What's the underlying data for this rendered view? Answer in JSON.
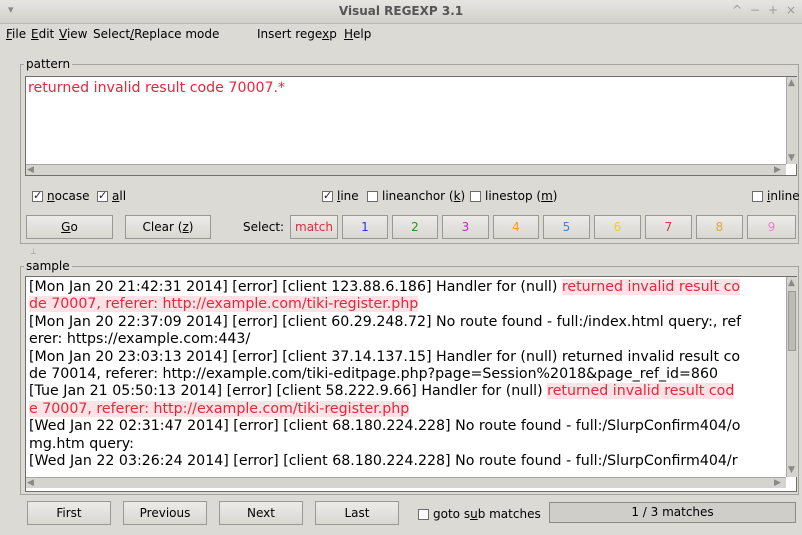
{
  "window": {
    "title": "Visual REGEXP 3.1",
    "controls": [
      "^",
      "−",
      "+",
      "×"
    ]
  },
  "menu": [
    {
      "pre": "",
      "u": "F",
      "post": "ile"
    },
    {
      "pre": "",
      "u": "E",
      "post": "dit"
    },
    {
      "pre": "",
      "u": "V",
      "post": "iew"
    },
    {
      "pre": "Select",
      "u": "/",
      "post": "Replace mode"
    },
    {
      "pre": "Insert rege",
      "u": "x",
      "post": "p"
    },
    {
      "pre": "",
      "u": "H",
      "post": "elp"
    }
  ],
  "pattern": {
    "label": "pattern",
    "value": "returned invalid result code 70007.*"
  },
  "options": {
    "nocase": {
      "pre": "",
      "u": "n",
      "post": "ocase",
      "checked": true
    },
    "all": {
      "pre": "",
      "u": "a",
      "post": "ll",
      "checked": true
    },
    "line": {
      "pre": "",
      "u": "l",
      "post": "ine",
      "checked": true
    },
    "lineanchor": {
      "text": "lineanchor (",
      "u": "k",
      "post": ")",
      "checked": false
    },
    "linestop": {
      "text": "linestop (",
      "u": "m",
      "post": ")",
      "checked": false
    },
    "inline": {
      "pre": "",
      "u": "i",
      "post": "nline",
      "checked": false
    }
  },
  "buttons": {
    "go": {
      "u": "G",
      "post": "o"
    },
    "clear": {
      "pre": "Clear (",
      "u": "z",
      "post": ")"
    }
  },
  "select": {
    "label": "Select:",
    "items": [
      {
        "label": "match",
        "color": "#e8263a"
      },
      {
        "label": "1",
        "color": "#2038d8"
      },
      {
        "label": "2",
        "color": "#1c9a1c"
      },
      {
        "label": "3",
        "color": "#c626c6"
      },
      {
        "label": "4",
        "color": "#f0a020"
      },
      {
        "label": "5",
        "color": "#4a7fd4"
      },
      {
        "label": "6",
        "color": "#e8d030"
      },
      {
        "label": "7",
        "color": "#d03a3a"
      },
      {
        "label": "8",
        "color": "#e0a838"
      },
      {
        "label": "9",
        "color": "#e880d0"
      }
    ]
  },
  "sample": {
    "label": "sample",
    "lines": [
      [
        {
          "t": "[Mon Jan 20 21:42:31 2014] [error] [client 123.88.6.186] Handler for (null) ",
          "m": false
        },
        {
          "t": "returned invalid result co",
          "m": true
        }
      ],
      [
        {
          "t": "de 70007, referer: http://example.com/tiki-register.php",
          "m": true
        }
      ],
      [
        {
          "t": "[Mon Jan 20 22:37:09 2014] [error] [client 60.29.248.72] No route found - full:/index.html query:, ref",
          "m": false
        }
      ],
      [
        {
          "t": "erer: https://example.com:443/",
          "m": false
        }
      ],
      [
        {
          "t": "[Mon Jan 20 23:03:13 2014] [error] [client 37.14.137.15] Handler for (null) returned invalid result co",
          "m": false
        }
      ],
      [
        {
          "t": "de 70014, referer: http://example.com/tiki-editpage.php?page=Session%2018&page_ref_id=860",
          "m": false
        }
      ],
      [
        {
          "t": "[Tue Jan 21 05:50:13 2014] [error] [client 58.222.9.66] Handler for (null) ",
          "m": false
        },
        {
          "t": "returned invalid result cod",
          "m": true
        }
      ],
      [
        {
          "t": "e 70007, referer: http://example.com/tiki-register.php",
          "m": true
        }
      ],
      [
        {
          "t": "[Wed Jan 22 02:31:47 2014] [error] [client 68.180.224.228] No route found - full:/SlurpConfirm404/o",
          "m": false
        }
      ],
      [
        {
          "t": "mg.htm query:",
          "m": false
        }
      ],
      [
        {
          "t": "[Wed Jan 22 03:26:24 2014] [error] [client 68.180.224.228] No route found - full:/SlurpConfirm404/r",
          "m": false
        }
      ]
    ]
  },
  "nav": {
    "first": "First",
    "previous": "Previous",
    "next": "Next",
    "last": "Last",
    "goto": {
      "pre": "goto s",
      "u": "u",
      "post": "b matches",
      "checked": false
    },
    "status": "1 / 3 matches"
  }
}
